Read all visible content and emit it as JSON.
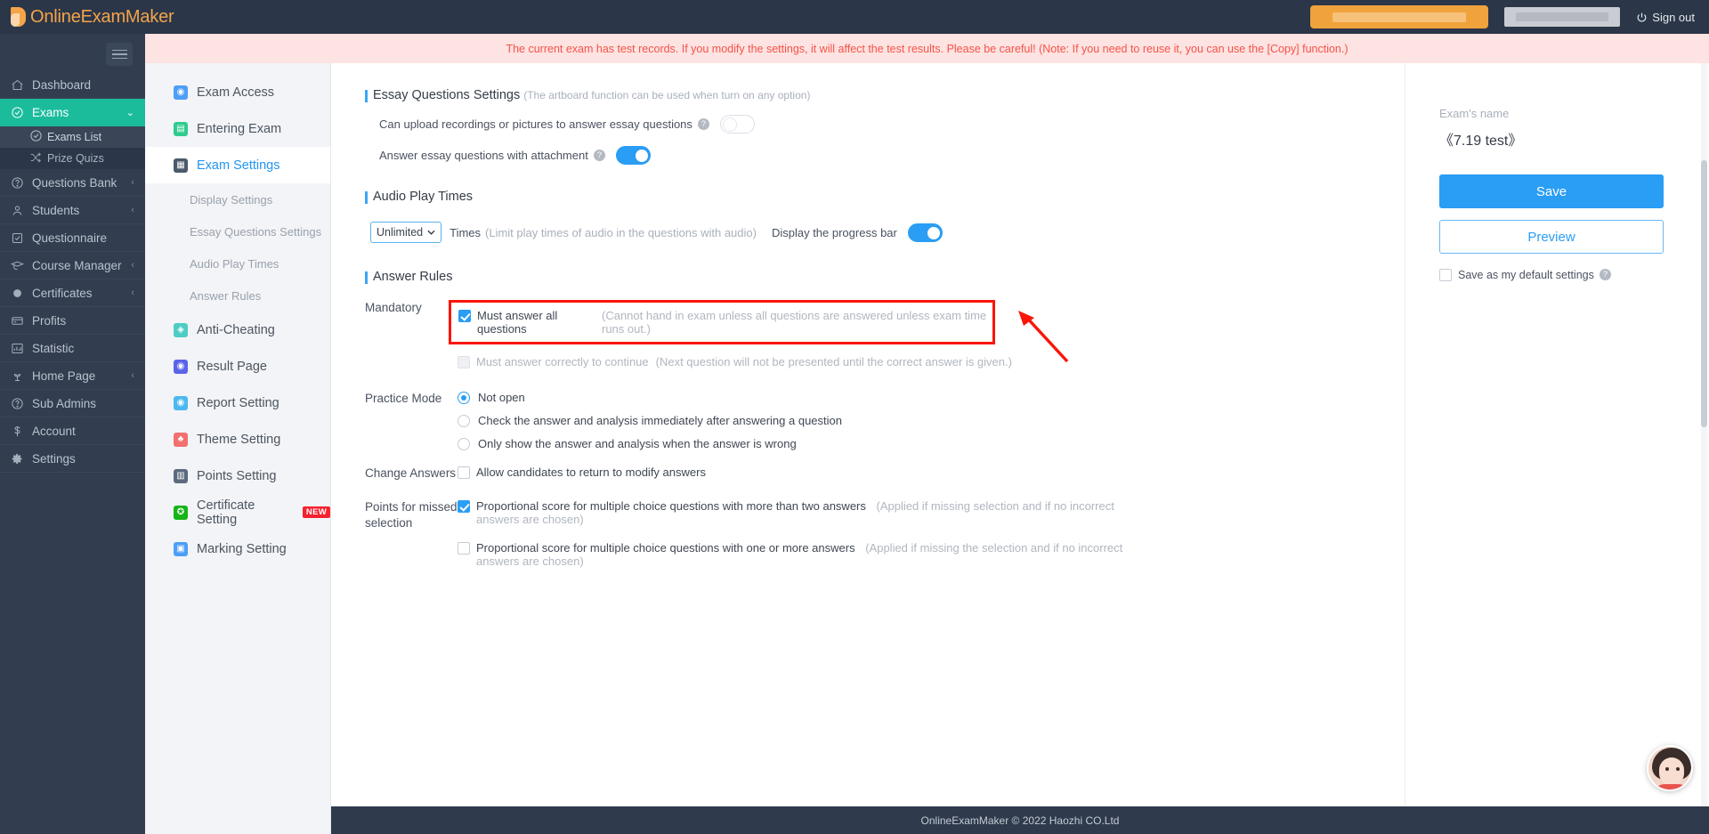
{
  "brand": {
    "name": "OnlineExamMaker"
  },
  "topbar": {
    "sign_out": "Sign out",
    "accent_orange": "#f0a23c"
  },
  "banner": {
    "text": "The current exam has test records. If you modify the settings, it will affect the test results. Please be careful! (Note: If you need to reuse it, you can use the [Copy] function.)",
    "color": "#f5534a",
    "background": "#fde3e1"
  },
  "sidebar": {
    "items": [
      {
        "label": "Dashboard",
        "icon": "home-icon",
        "has_chevron": false
      },
      {
        "label": "Exams",
        "icon": "check-circle-icon",
        "has_chevron": true,
        "active": true
      },
      {
        "label": "Questions Bank",
        "icon": "question-circle-icon",
        "has_chevron": true
      },
      {
        "label": "Students",
        "icon": "user-icon",
        "has_chevron": true
      },
      {
        "label": "Questionnaire",
        "icon": "checkbox-icon",
        "has_chevron": false
      },
      {
        "label": "Course Manager",
        "icon": "graduation-cap-icon",
        "has_chevron": true
      },
      {
        "label": "Certificates",
        "icon": "badge-icon",
        "has_chevron": true
      },
      {
        "label": "Profits",
        "icon": "card-icon",
        "has_chevron": false
      },
      {
        "label": "Statistic",
        "icon": "bar-chart-icon",
        "has_chevron": false
      },
      {
        "label": "Home Page",
        "icon": "plant-icon",
        "has_chevron": true
      },
      {
        "label": "Sub Admins",
        "icon": "question-circle-icon",
        "has_chevron": false
      },
      {
        "label": "Account",
        "icon": "dollar-icon",
        "has_chevron": false
      },
      {
        "label": "Settings",
        "icon": "gear-icon",
        "has_chevron": false
      }
    ],
    "subitems": [
      {
        "label": "Exams List",
        "icon": "check-circle-icon",
        "selected": true
      },
      {
        "label": "Prize Quizs",
        "icon": "shuffle-icon",
        "selected": false
      }
    ],
    "active_accent": "#1abc9c"
  },
  "panel2": {
    "items": [
      {
        "label": "Exam Access",
        "icon": "location-icon",
        "color": "#4d9ef6",
        "type": "main"
      },
      {
        "label": "Entering Exam",
        "icon": "document-icon",
        "color": "#2ecc8f",
        "type": "main"
      },
      {
        "label": "Exam Settings",
        "icon": "window-icon",
        "color": "#4a5a6a",
        "type": "main",
        "current": true
      },
      {
        "label": "Display Settings",
        "type": "sub"
      },
      {
        "label": "Essay Questions Settings",
        "type": "sub"
      },
      {
        "label": "Audio Play Times",
        "type": "sub"
      },
      {
        "label": "Answer Rules",
        "type": "sub"
      },
      {
        "label": "Anti-Cheating",
        "icon": "shield-icon",
        "color": "#4ecdc4",
        "type": "main"
      },
      {
        "label": "Result Page",
        "icon": "eye-icon",
        "color": "#5b63e8",
        "type": "main"
      },
      {
        "label": "Report Setting",
        "icon": "report-icon",
        "color": "#4db8f0",
        "type": "main"
      },
      {
        "label": "Theme Setting",
        "icon": "shirt-icon",
        "color": "#f2706e",
        "type": "main"
      },
      {
        "label": "Points Setting",
        "icon": "points-icon",
        "color": "#5b6a7d",
        "type": "main"
      },
      {
        "label": "Certificate Setting",
        "icon": "certificate-icon",
        "color": "#16b516",
        "type": "main",
        "badge": "NEW"
      },
      {
        "label": "Marking Setting",
        "icon": "marking-icon",
        "color": "#4d9ef6",
        "type": "main"
      }
    ]
  },
  "main": {
    "essay": {
      "title": "Essay Questions Settings",
      "hint": "(The artboard function can be used when turn on any option)",
      "opt_upload": "Can upload recordings or pictures to answer essay questions",
      "opt_upload_state": "off",
      "opt_attachment": "Answer essay questions with attachment",
      "opt_attachment_state": "on"
    },
    "audio": {
      "title": "Audio Play Times",
      "select_value": "Unlimited",
      "times_label": "Times",
      "times_hint": "(Limit play times of audio in the questions with audio)",
      "progress_label": "Display the progress bar",
      "progress_state": "on"
    },
    "answer_rules": {
      "title": "Answer Rules",
      "mandatory_label": "Mandatory",
      "mandatory_opt1": "Must answer all questions",
      "mandatory_opt1_note": "(Cannot hand in exam unless all questions are answered unless exam time runs out.)",
      "mandatory_opt1_checked": true,
      "mandatory_opt1_highlighted": true,
      "mandatory_opt2": "Must answer correctly to continue",
      "mandatory_opt2_note": "(Next question will not be presented until the correct answer is given.)",
      "mandatory_opt2_checked": false,
      "practice_label": "Practice Mode",
      "practice_options": [
        {
          "label": "Not open",
          "selected": true
        },
        {
          "label": "Check the answer and analysis immediately after answering a question",
          "selected": false
        },
        {
          "label": "Only show the answer and analysis when the answer is wrong",
          "selected": false
        }
      ],
      "change_label": "Change Answers",
      "change_opt": "Allow candidates to return to modify answers",
      "change_checked": false,
      "points_label": "Points for missed selection",
      "points_opt1": "Proportional score for multiple choice questions with more than two answers",
      "points_opt1_note": "(Applied if missing selection and if no incorrect answers are chosen)",
      "points_opt1_checked": true,
      "points_opt2": "Proportional score for multiple choice questions with one or more answers",
      "points_opt2_note": "(Applied if missing the selection and if no incorrect answers are chosen)",
      "points_opt2_checked": false
    },
    "highlight_color": "#fa1508",
    "arrow_color": "#fa1508"
  },
  "rightpanel": {
    "exam_name_label": "Exam's name",
    "exam_name_value": "《7.19 test》",
    "save_label": "Save",
    "preview_label": "Preview",
    "default_label": "Save as my default settings",
    "default_checked": false,
    "accent": "#2a9df4"
  },
  "footer": {
    "text": "OnlineExamMaker © 2022 Haozhi CO.Ltd"
  }
}
